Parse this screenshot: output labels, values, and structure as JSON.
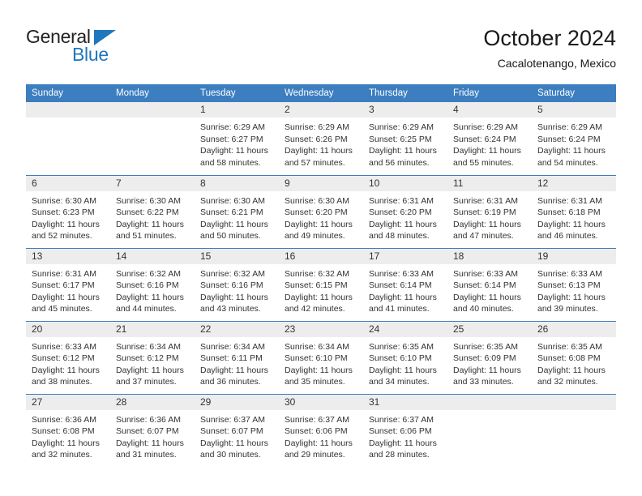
{
  "brand": {
    "name_part1": "General",
    "name_part2": "Blue",
    "triangle_icon": "triangle-icon",
    "accent_color": "#1f77bd"
  },
  "header": {
    "title": "October 2024",
    "subtitle": "Cacalotenango, Mexico"
  },
  "calendar": {
    "header_color": "#3c7ebf",
    "daynum_band_color": "#ededed",
    "weekday_headers": [
      "Sunday",
      "Monday",
      "Tuesday",
      "Wednesday",
      "Thursday",
      "Friday",
      "Saturday"
    ],
    "weeks": [
      [
        {
          "day": "",
          "sunrise": "",
          "sunset": "",
          "daylight_line1": "",
          "daylight_line2": ""
        },
        {
          "day": "",
          "sunrise": "",
          "sunset": "",
          "daylight_line1": "",
          "daylight_line2": ""
        },
        {
          "day": "1",
          "sunrise": "Sunrise: 6:29 AM",
          "sunset": "Sunset: 6:27 PM",
          "daylight_line1": "Daylight: 11 hours",
          "daylight_line2": "and 58 minutes."
        },
        {
          "day": "2",
          "sunrise": "Sunrise: 6:29 AM",
          "sunset": "Sunset: 6:26 PM",
          "daylight_line1": "Daylight: 11 hours",
          "daylight_line2": "and 57 minutes."
        },
        {
          "day": "3",
          "sunrise": "Sunrise: 6:29 AM",
          "sunset": "Sunset: 6:25 PM",
          "daylight_line1": "Daylight: 11 hours",
          "daylight_line2": "and 56 minutes."
        },
        {
          "day": "4",
          "sunrise": "Sunrise: 6:29 AM",
          "sunset": "Sunset: 6:24 PM",
          "daylight_line1": "Daylight: 11 hours",
          "daylight_line2": "and 55 minutes."
        },
        {
          "day": "5",
          "sunrise": "Sunrise: 6:29 AM",
          "sunset": "Sunset: 6:24 PM",
          "daylight_line1": "Daylight: 11 hours",
          "daylight_line2": "and 54 minutes."
        }
      ],
      [
        {
          "day": "6",
          "sunrise": "Sunrise: 6:30 AM",
          "sunset": "Sunset: 6:23 PM",
          "daylight_line1": "Daylight: 11 hours",
          "daylight_line2": "and 52 minutes."
        },
        {
          "day": "7",
          "sunrise": "Sunrise: 6:30 AM",
          "sunset": "Sunset: 6:22 PM",
          "daylight_line1": "Daylight: 11 hours",
          "daylight_line2": "and 51 minutes."
        },
        {
          "day": "8",
          "sunrise": "Sunrise: 6:30 AM",
          "sunset": "Sunset: 6:21 PM",
          "daylight_line1": "Daylight: 11 hours",
          "daylight_line2": "and 50 minutes."
        },
        {
          "day": "9",
          "sunrise": "Sunrise: 6:30 AM",
          "sunset": "Sunset: 6:20 PM",
          "daylight_line1": "Daylight: 11 hours",
          "daylight_line2": "and 49 minutes."
        },
        {
          "day": "10",
          "sunrise": "Sunrise: 6:31 AM",
          "sunset": "Sunset: 6:20 PM",
          "daylight_line1": "Daylight: 11 hours",
          "daylight_line2": "and 48 minutes."
        },
        {
          "day": "11",
          "sunrise": "Sunrise: 6:31 AM",
          "sunset": "Sunset: 6:19 PM",
          "daylight_line1": "Daylight: 11 hours",
          "daylight_line2": "and 47 minutes."
        },
        {
          "day": "12",
          "sunrise": "Sunrise: 6:31 AM",
          "sunset": "Sunset: 6:18 PM",
          "daylight_line1": "Daylight: 11 hours",
          "daylight_line2": "and 46 minutes."
        }
      ],
      [
        {
          "day": "13",
          "sunrise": "Sunrise: 6:31 AM",
          "sunset": "Sunset: 6:17 PM",
          "daylight_line1": "Daylight: 11 hours",
          "daylight_line2": "and 45 minutes."
        },
        {
          "day": "14",
          "sunrise": "Sunrise: 6:32 AM",
          "sunset": "Sunset: 6:16 PM",
          "daylight_line1": "Daylight: 11 hours",
          "daylight_line2": "and 44 minutes."
        },
        {
          "day": "15",
          "sunrise": "Sunrise: 6:32 AM",
          "sunset": "Sunset: 6:16 PM",
          "daylight_line1": "Daylight: 11 hours",
          "daylight_line2": "and 43 minutes."
        },
        {
          "day": "16",
          "sunrise": "Sunrise: 6:32 AM",
          "sunset": "Sunset: 6:15 PM",
          "daylight_line1": "Daylight: 11 hours",
          "daylight_line2": "and 42 minutes."
        },
        {
          "day": "17",
          "sunrise": "Sunrise: 6:33 AM",
          "sunset": "Sunset: 6:14 PM",
          "daylight_line1": "Daylight: 11 hours",
          "daylight_line2": "and 41 minutes."
        },
        {
          "day": "18",
          "sunrise": "Sunrise: 6:33 AM",
          "sunset": "Sunset: 6:14 PM",
          "daylight_line1": "Daylight: 11 hours",
          "daylight_line2": "and 40 minutes."
        },
        {
          "day": "19",
          "sunrise": "Sunrise: 6:33 AM",
          "sunset": "Sunset: 6:13 PM",
          "daylight_line1": "Daylight: 11 hours",
          "daylight_line2": "and 39 minutes."
        }
      ],
      [
        {
          "day": "20",
          "sunrise": "Sunrise: 6:33 AM",
          "sunset": "Sunset: 6:12 PM",
          "daylight_line1": "Daylight: 11 hours",
          "daylight_line2": "and 38 minutes."
        },
        {
          "day": "21",
          "sunrise": "Sunrise: 6:34 AM",
          "sunset": "Sunset: 6:12 PM",
          "daylight_line1": "Daylight: 11 hours",
          "daylight_line2": "and 37 minutes."
        },
        {
          "day": "22",
          "sunrise": "Sunrise: 6:34 AM",
          "sunset": "Sunset: 6:11 PM",
          "daylight_line1": "Daylight: 11 hours",
          "daylight_line2": "and 36 minutes."
        },
        {
          "day": "23",
          "sunrise": "Sunrise: 6:34 AM",
          "sunset": "Sunset: 6:10 PM",
          "daylight_line1": "Daylight: 11 hours",
          "daylight_line2": "and 35 minutes."
        },
        {
          "day": "24",
          "sunrise": "Sunrise: 6:35 AM",
          "sunset": "Sunset: 6:10 PM",
          "daylight_line1": "Daylight: 11 hours",
          "daylight_line2": "and 34 minutes."
        },
        {
          "day": "25",
          "sunrise": "Sunrise: 6:35 AM",
          "sunset": "Sunset: 6:09 PM",
          "daylight_line1": "Daylight: 11 hours",
          "daylight_line2": "and 33 minutes."
        },
        {
          "day": "26",
          "sunrise": "Sunrise: 6:35 AM",
          "sunset": "Sunset: 6:08 PM",
          "daylight_line1": "Daylight: 11 hours",
          "daylight_line2": "and 32 minutes."
        }
      ],
      [
        {
          "day": "27",
          "sunrise": "Sunrise: 6:36 AM",
          "sunset": "Sunset: 6:08 PM",
          "daylight_line1": "Daylight: 11 hours",
          "daylight_line2": "and 32 minutes."
        },
        {
          "day": "28",
          "sunrise": "Sunrise: 6:36 AM",
          "sunset": "Sunset: 6:07 PM",
          "daylight_line1": "Daylight: 11 hours",
          "daylight_line2": "and 31 minutes."
        },
        {
          "day": "29",
          "sunrise": "Sunrise: 6:37 AM",
          "sunset": "Sunset: 6:07 PM",
          "daylight_line1": "Daylight: 11 hours",
          "daylight_line2": "and 30 minutes."
        },
        {
          "day": "30",
          "sunrise": "Sunrise: 6:37 AM",
          "sunset": "Sunset: 6:06 PM",
          "daylight_line1": "Daylight: 11 hours",
          "daylight_line2": "and 29 minutes."
        },
        {
          "day": "31",
          "sunrise": "Sunrise: 6:37 AM",
          "sunset": "Sunset: 6:06 PM",
          "daylight_line1": "Daylight: 11 hours",
          "daylight_line2": "and 28 minutes."
        },
        {
          "day": "",
          "sunrise": "",
          "sunset": "",
          "daylight_line1": "",
          "daylight_line2": ""
        },
        {
          "day": "",
          "sunrise": "",
          "sunset": "",
          "daylight_line1": "",
          "daylight_line2": ""
        }
      ]
    ]
  }
}
